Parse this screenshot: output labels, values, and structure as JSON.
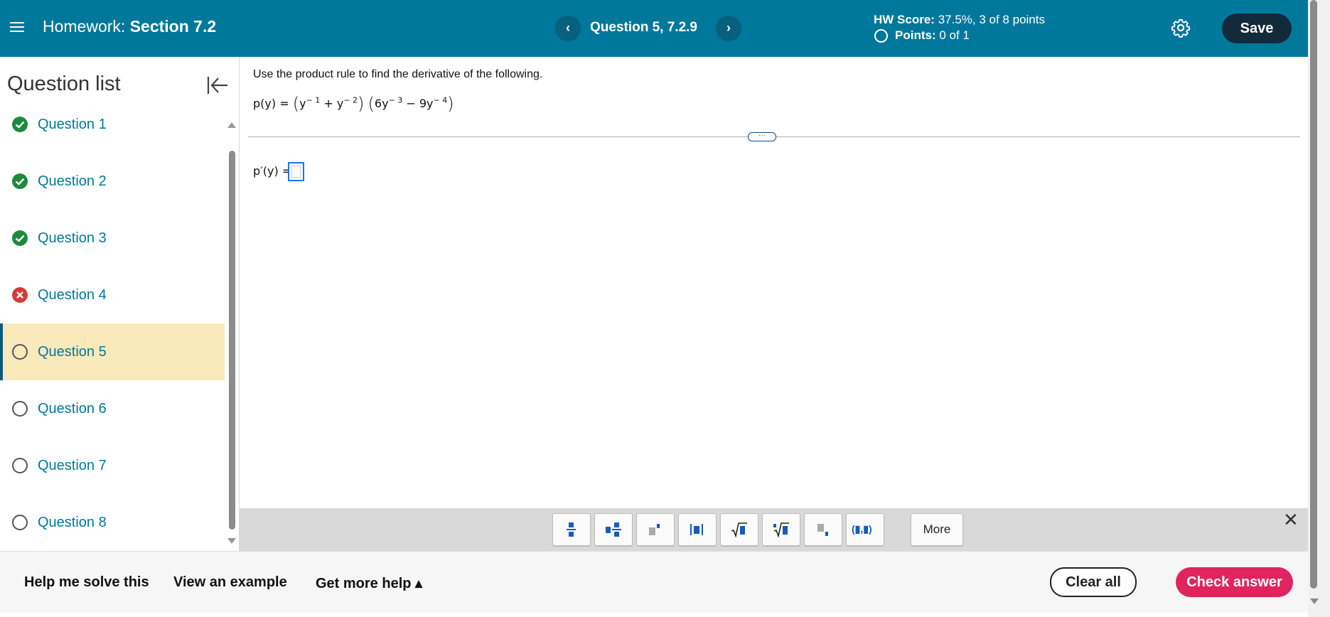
{
  "header": {
    "homework_prefix": "Homework:",
    "section": "Section 7.2",
    "question_title": "Question 5, 7.2.9",
    "prev_glyph": "‹",
    "next_glyph": "›",
    "hw_score_label": "HW Score:",
    "hw_score_value": "37.5%, 3 of 8 points",
    "points_label": "Points:",
    "points_value": "0 of 1",
    "save_label": "Save"
  },
  "sidebar": {
    "title": "Question list",
    "items": [
      {
        "label": "Question 1",
        "status": "correct"
      },
      {
        "label": "Question 2",
        "status": "correct"
      },
      {
        "label": "Question 3",
        "status": "correct"
      },
      {
        "label": "Question 4",
        "status": "incorrect"
      },
      {
        "label": "Question 5",
        "status": "current"
      },
      {
        "label": "Question 6",
        "status": "unanswered"
      },
      {
        "label": "Question 7",
        "status": "unanswered"
      },
      {
        "label": "Question 8",
        "status": "unanswered"
      }
    ]
  },
  "question": {
    "instruction": "Use the product rule to find the derivative of the following.",
    "func_lhs": "p(y) =",
    "y1": "y",
    "e1": "− 1",
    "plus": "+",
    "y2": "y",
    "e2": "− 2",
    "c3": "6y",
    "e3": "− 3",
    "minus": "−",
    "c4": "9y",
    "e4": "− 4",
    "answer_label": "p′(y) =",
    "expand_glyph": "···"
  },
  "math_toolbar": {
    "tools": [
      "fraction",
      "mixed-number",
      "exponent",
      "absolute-value",
      "square-root",
      "nth-root",
      "subscript",
      "ordered-pair"
    ],
    "ordered_pair_text": "(▮,▮)",
    "more_label": "More",
    "close_glyph": "✕"
  },
  "footer": {
    "help_solve": "Help me solve this",
    "view_example": "View an example",
    "get_more_help": "Get more help ▴",
    "clear_all": "Clear all",
    "check_answer": "Check answer"
  },
  "colors": {
    "header_bg": "#00789b",
    "save_bg": "#132a3a",
    "correct": "#1e8a3c",
    "incorrect": "#d43b3b",
    "current_bg": "#faeabb",
    "link": "#00789b",
    "check_bg": "#e0245e",
    "toolbar_blue": "#1a5ab8"
  }
}
